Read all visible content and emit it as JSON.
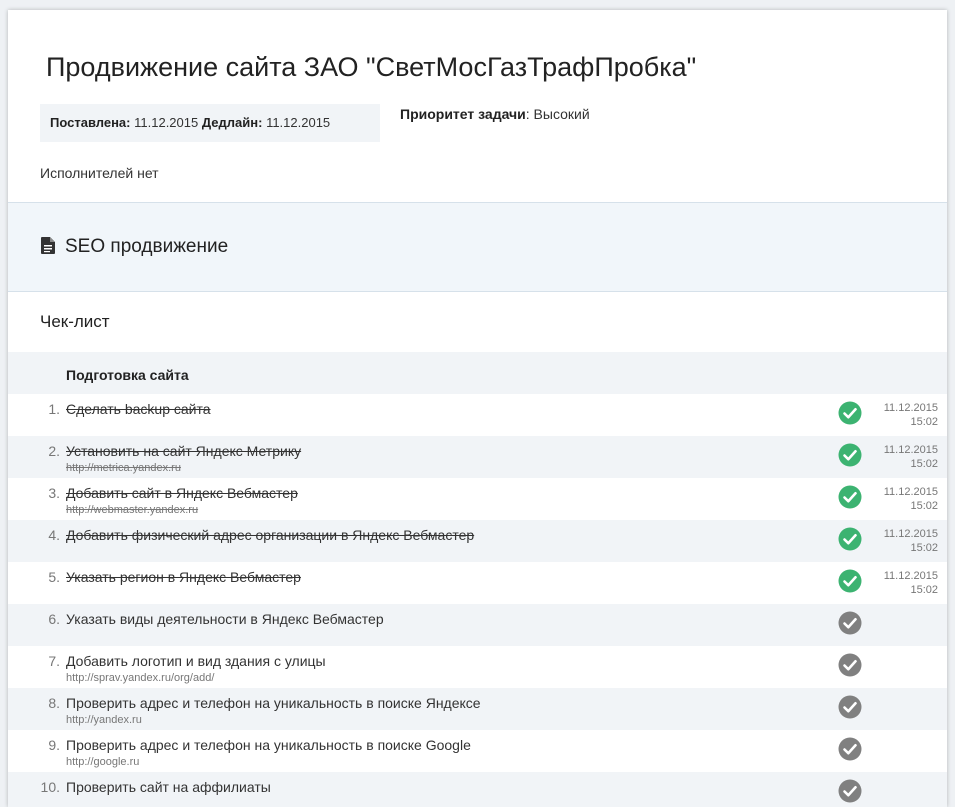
{
  "task": {
    "title": "Продвижение сайта ЗАО \"СветМосГазТрафПробка\"",
    "posted_label": "Поставлена:",
    "posted_value": "11.12.2015",
    "deadline_label": "Дедлайн:",
    "deadline_value": "11.12.2015",
    "priority_label": "Приоритет задачи",
    "priority_value": ": Высокий",
    "executors": "Исполнителей нет"
  },
  "section": {
    "icon": "document-icon",
    "title": "SEO продвижение"
  },
  "checklist": {
    "title": "Чек-лист",
    "group": "Подготовка сайта",
    "colors": {
      "done": "#3cb371",
      "pending": "#808080"
    },
    "items": [
      {
        "num": "1.",
        "text": "Сделать backup сайта",
        "url": "",
        "done": true,
        "date": "11.12.2015",
        "time": "15:02"
      },
      {
        "num": "2.",
        "text": "Установить на сайт Яндекс Метрику",
        "url": "http://metrica.yandex.ru",
        "done": true,
        "date": "11.12.2015",
        "time": "15:02"
      },
      {
        "num": "3.",
        "text": "Добавить сайт в Яндекс Вебмастер",
        "url": "http://webmaster.yandex.ru",
        "done": true,
        "date": "11.12.2015",
        "time": "15:02"
      },
      {
        "num": "4.",
        "text": "Добавить физический адрес организации в Яндекс Вебмастер",
        "url": "",
        "done": true,
        "date": "11.12.2015",
        "time": "15:02"
      },
      {
        "num": "5.",
        "text": "Указать регион в Яндекс Вебмастер",
        "url": "",
        "done": true,
        "date": "11.12.2015",
        "time": "15:02"
      },
      {
        "num": "6.",
        "text": "Указать виды деятельности в Яндекс Вебмастер",
        "url": "",
        "done": false,
        "date": "",
        "time": ""
      },
      {
        "num": "7.",
        "text": "Добавить логотип и вид здания с улицы",
        "url": "http://sprav.yandex.ru/org/add/",
        "done": false,
        "date": "",
        "time": ""
      },
      {
        "num": "8.",
        "text": "Проверить адрес и телефон на уникальность в поиске Яндексе",
        "url": "http://yandex.ru",
        "done": false,
        "date": "",
        "time": ""
      },
      {
        "num": "9.",
        "text": "Проверить адрес и телефон на уникальность в поиске Google",
        "url": "http://google.ru",
        "done": false,
        "date": "",
        "time": ""
      },
      {
        "num": "10.",
        "text": "Проверить сайт на аффилиаты",
        "url": "",
        "done": false,
        "date": "",
        "time": ""
      }
    ]
  }
}
